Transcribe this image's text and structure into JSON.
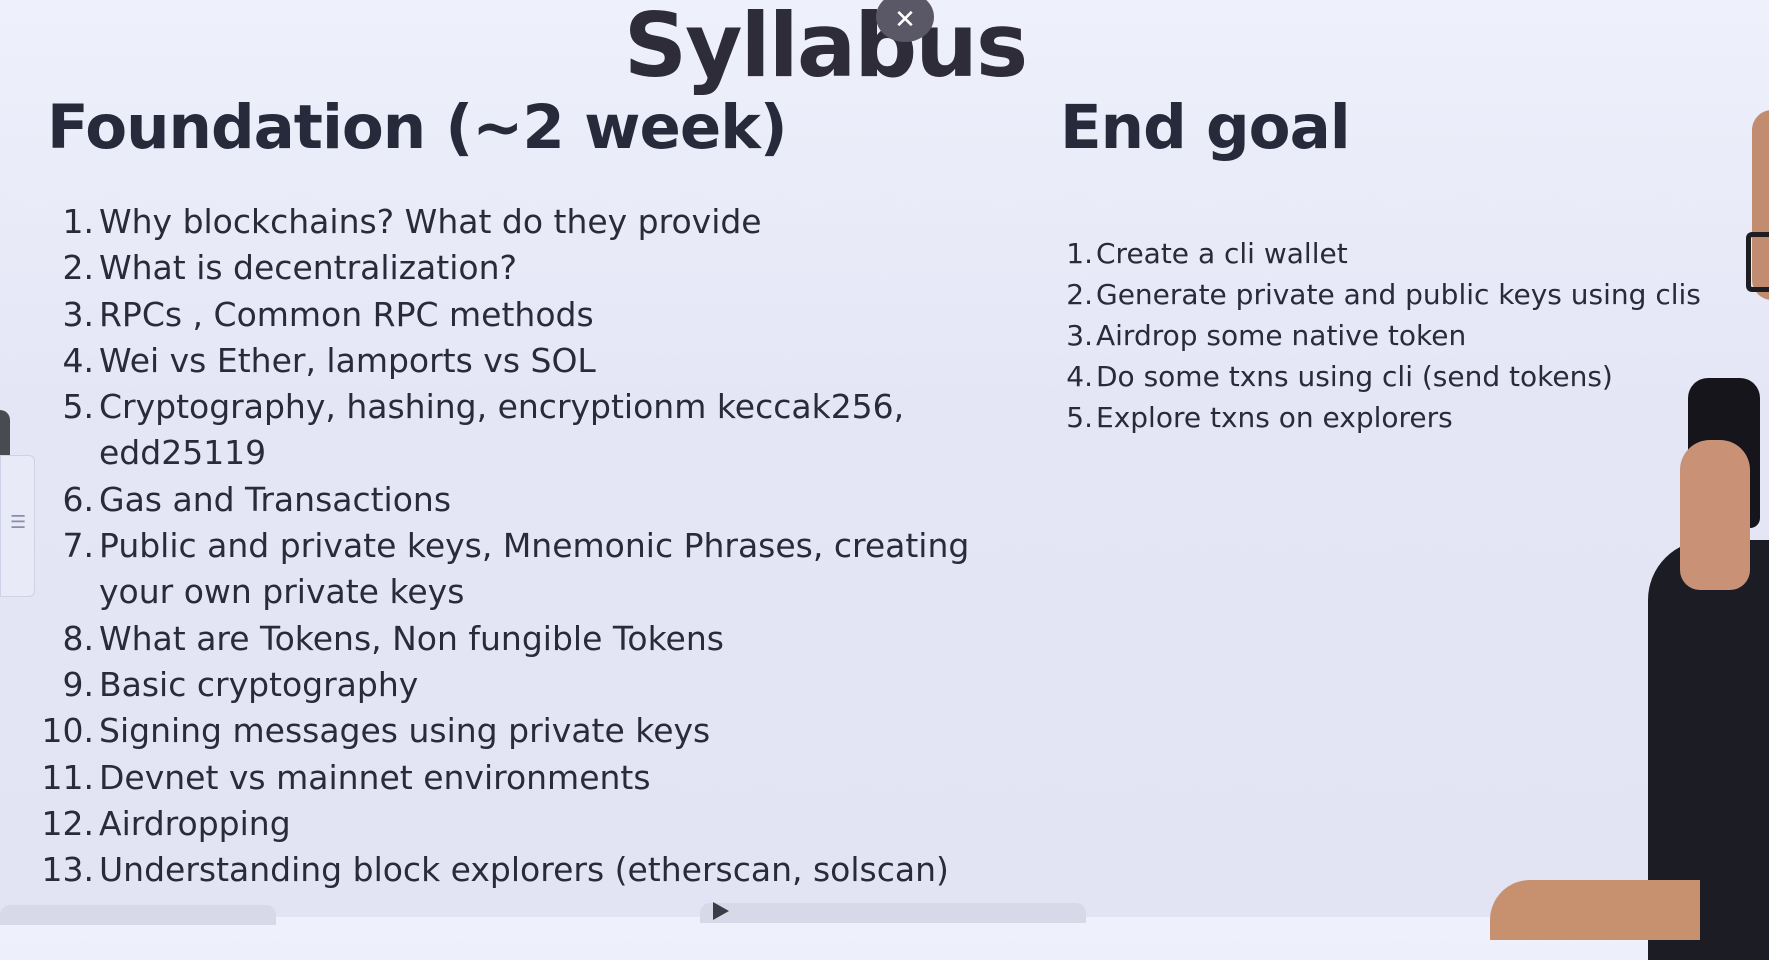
{
  "slide": {
    "title": "Syllabus",
    "close_label": "✕",
    "foundation": {
      "heading": "Foundation (~2 week)",
      "items": [
        {
          "num": "1.",
          "text": "Why blockchains? What do they provide"
        },
        {
          "num": "2.",
          "text": "What is decentralization?"
        },
        {
          "num": "3.",
          "text": "RPCs , Common RPC methods"
        },
        {
          "num": "4.",
          "text": "Wei vs Ether, lamports vs SOL"
        },
        {
          "num": "5.",
          "text": "Cryptography, hashing, encryptionm keccak256, edd25119"
        },
        {
          "num": "6.",
          "text": "Gas and Transactions"
        },
        {
          "num": "7.",
          "text": "Public and private keys, Mnemonic Phrases, creating your own private keys"
        },
        {
          "num": "8.",
          "text": "What are Tokens, Non fungible Tokens"
        },
        {
          "num": "9.",
          "text": "Basic cryptography"
        },
        {
          "num": "10.",
          "text": "Signing messages using private keys"
        },
        {
          "num": "11.",
          "text": "Devnet vs mainnet environments"
        },
        {
          "num": "12.",
          "text": "Airdropping"
        },
        {
          "num": "13.",
          "text": "Understanding block explorers (etherscan, solscan)"
        }
      ]
    },
    "end_goal": {
      "heading": "End goal",
      "items": [
        {
          "num": "1.",
          "text": "Create a cli wallet"
        },
        {
          "num": "2.",
          "text": "Generate private and public keys using clis"
        },
        {
          "num": "3.",
          "text": "Airdrop some native token"
        },
        {
          "num": "4.",
          "text": "Do some txns using cli (send tokens)"
        },
        {
          "num": "5.",
          "text": "Explore txns on explorers"
        }
      ]
    }
  },
  "icons": {
    "close": "close-icon",
    "play": "play-icon",
    "side_panel": "side-panel-icon"
  }
}
